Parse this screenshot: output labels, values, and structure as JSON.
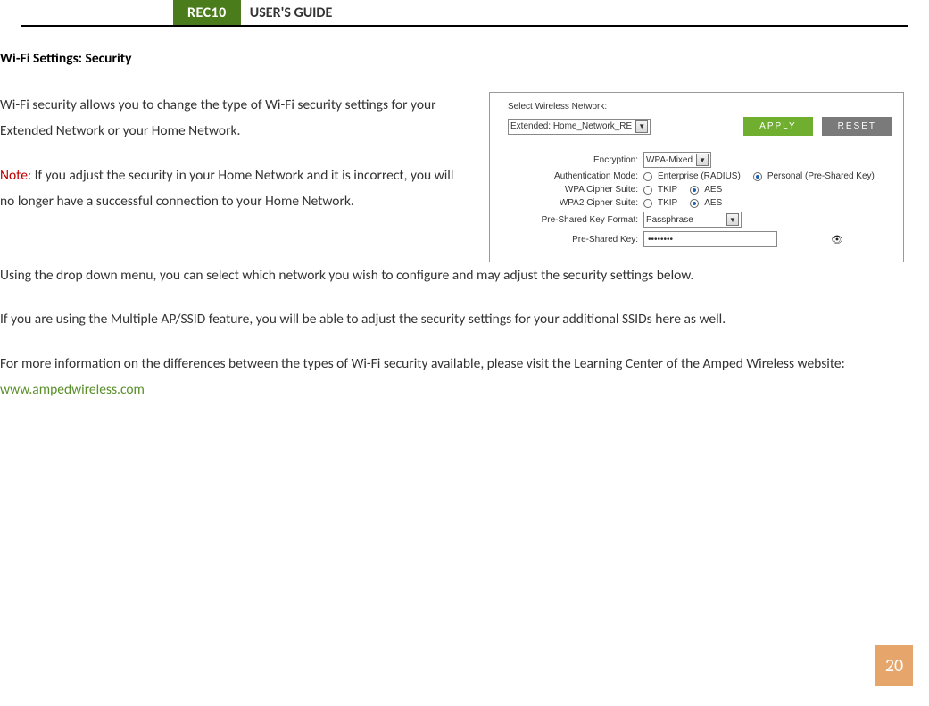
{
  "header": {
    "tab": "REC10",
    "title": "USER'S GUIDE"
  },
  "section_title": "Wi-Fi Settings: Security",
  "paragraphs": {
    "p1": "Wi-Fi security allows you to change the type of Wi-Fi security settings for your Extended Network or your Home Network.",
    "note_label": "Note:",
    "note_body": " If you adjust the security in your Home Network and it is incorrect, you will no longer have a successful connection to your Home Network.",
    "p3": "Using the drop down menu, you can select which network you wish to configure and may adjust the security settings below.",
    "p4": "If you are using the Multiple AP/SSID feature, you will be able to adjust the security settings for your additional SSIDs here as well.",
    "p5a": "For more information on the differences between the types of Wi-Fi security available, please visit the Learning Center of the Amped Wireless website:  ",
    "link_text": "www.ampedwireless.com"
  },
  "panel": {
    "select_label": "Select Wireless Network:",
    "network_value": "Extended: Home_Network_RE",
    "apply": "APPLY",
    "reset": "RESET",
    "encryption_label": "Encryption:",
    "encryption_value": "WPA-Mixed",
    "auth_label": "Authentication Mode:",
    "auth_opt1": "Enterprise (RADIUS)",
    "auth_opt2": "Personal (Pre-Shared Key)",
    "wpa_label": "WPA Cipher Suite:",
    "wpa2_label": "WPA2 Cipher Suite:",
    "cipher_opt1": "TKIP",
    "cipher_opt2": "AES",
    "psk_format_label": "Pre-Shared Key Format:",
    "psk_format_value": "Passphrase",
    "psk_label": "Pre-Shared Key:",
    "psk_value": "••••••••"
  },
  "page_number": "20"
}
